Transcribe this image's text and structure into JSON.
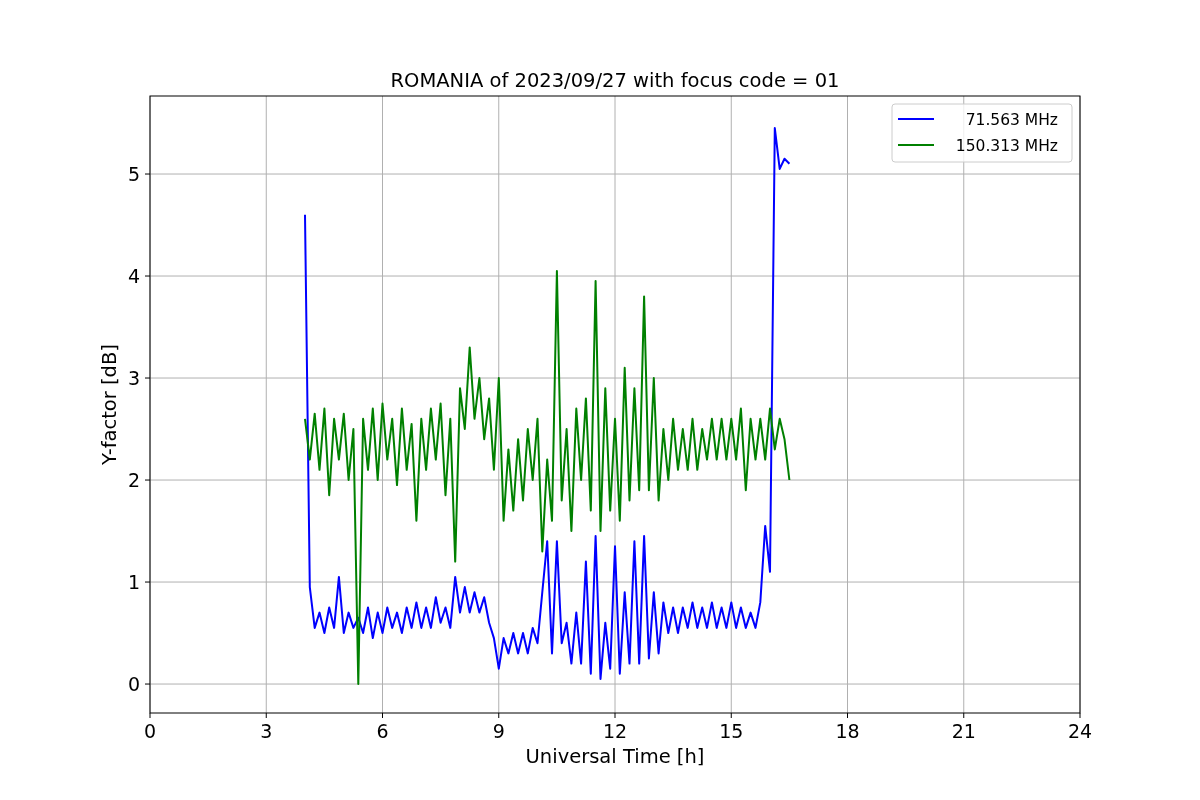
{
  "figure": {
    "chart_data": {
      "type": "line",
      "title": "ROMANIA of 2023/09/27 with focus code = 01",
      "xlabel": "Universal Time [h]",
      "ylabel": "Y-factor [dB]",
      "xlim": [
        0,
        24
      ],
      "ylim": [
        -0.284,
        5.765
      ],
      "xticks": [
        0,
        3,
        6,
        9,
        12,
        15,
        18,
        21,
        24
      ],
      "yticks": [
        0,
        1,
        2,
        3,
        4,
        5
      ],
      "grid": true,
      "legend": true,
      "x": [
        4,
        4.125,
        4.25,
        4.375,
        4.5,
        4.625,
        4.75,
        4.875,
        5,
        5.125,
        5.25,
        5.375,
        5.5,
        5.625,
        5.75,
        5.875,
        6,
        6.125,
        6.25,
        6.375,
        6.5,
        6.625,
        6.75,
        6.875,
        7,
        7.125,
        7.25,
        7.375,
        7.5,
        7.625,
        7.75,
        7.875,
        8,
        8.125,
        8.25,
        8.375,
        8.5,
        8.625,
        8.75,
        8.875,
        9,
        9.125,
        9.25,
        9.375,
        9.5,
        9.625,
        9.75,
        9.875,
        10,
        10.125,
        10.25,
        10.375,
        10.5,
        10.625,
        10.75,
        10.875,
        11,
        11.125,
        11.25,
        11.375,
        11.5,
        11.625,
        11.75,
        11.875,
        12,
        12.125,
        12.25,
        12.375,
        12.5,
        12.625,
        12.75,
        12.875,
        13,
        13.125,
        13.25,
        13.375,
        13.5,
        13.625,
        13.75,
        13.875,
        14,
        14.125,
        14.25,
        14.375,
        14.5,
        14.625,
        14.75,
        14.875,
        15,
        15.125,
        15.25,
        15.375,
        15.5,
        15.625,
        15.75,
        15.875,
        16,
        16.125,
        16.25,
        16.375,
        16.5
      ],
      "series": [
        {
          "name": "71.563 MHz",
          "color": "#0000ff",
          "values": [
            4.6,
            0.95,
            0.55,
            0.7,
            0.5,
            0.75,
            0.55,
            1.05,
            0.5,
            0.7,
            0.55,
            0.65,
            0.5,
            0.75,
            0.45,
            0.7,
            0.5,
            0.75,
            0.55,
            0.7,
            0.5,
            0.75,
            0.55,
            0.8,
            0.55,
            0.75,
            0.55,
            0.85,
            0.6,
            0.75,
            0.55,
            1.05,
            0.7,
            0.95,
            0.7,
            0.9,
            0.7,
            0.85,
            0.6,
            0.45,
            0.15,
            0.45,
            0.3,
            0.5,
            0.3,
            0.5,
            0.3,
            0.55,
            0.4,
            0.9,
            1.4,
            0.3,
            1.4,
            0.4,
            0.6,
            0.2,
            0.7,
            0.2,
            1.2,
            0.1,
            1.45,
            0.05,
            0.6,
            0.15,
            1.35,
            0.1,
            0.9,
            0.2,
            1.4,
            0.2,
            1.45,
            0.25,
            0.9,
            0.3,
            0.8,
            0.5,
            0.75,
            0.5,
            0.75,
            0.55,
            0.8,
            0.55,
            0.75,
            0.55,
            0.8,
            0.55,
            0.75,
            0.55,
            0.8,
            0.55,
            0.75,
            0.55,
            0.7,
            0.55,
            0.8,
            1.55,
            1.1,
            5.45,
            5.05,
            5.15,
            5.1
          ]
        },
        {
          "name": "150.313 MHz",
          "color": "#008000",
          "values": [
            2.6,
            2.2,
            2.65,
            2.1,
            2.7,
            1.85,
            2.6,
            2.2,
            2.65,
            2.0,
            2.5,
            0.0,
            2.6,
            2.1,
            2.7,
            2.0,
            2.75,
            2.2,
            2.6,
            1.95,
            2.7,
            2.1,
            2.55,
            1.6,
            2.6,
            2.1,
            2.7,
            2.2,
            2.75,
            1.85,
            2.6,
            1.2,
            2.9,
            2.5,
            3.3,
            2.6,
            3.0,
            2.4,
            2.8,
            2.1,
            3.0,
            1.6,
            2.3,
            1.7,
            2.4,
            1.8,
            2.5,
            2.0,
            2.6,
            1.3,
            2.2,
            1.6,
            4.05,
            1.8,
            2.5,
            1.5,
            2.7,
            2.0,
            2.8,
            1.7,
            3.95,
            1.5,
            2.9,
            1.7,
            2.6,
            1.6,
            3.1,
            1.8,
            2.9,
            1.9,
            3.8,
            1.9,
            3.0,
            1.8,
            2.5,
            2.0,
            2.6,
            2.1,
            2.5,
            2.1,
            2.6,
            2.1,
            2.5,
            2.2,
            2.6,
            2.2,
            2.6,
            2.2,
            2.6,
            2.2,
            2.7,
            1.9,
            2.6,
            2.2,
            2.6,
            2.2,
            2.7,
            2.3,
            2.6,
            2.4,
            2.0
          ]
        }
      ]
    }
  }
}
